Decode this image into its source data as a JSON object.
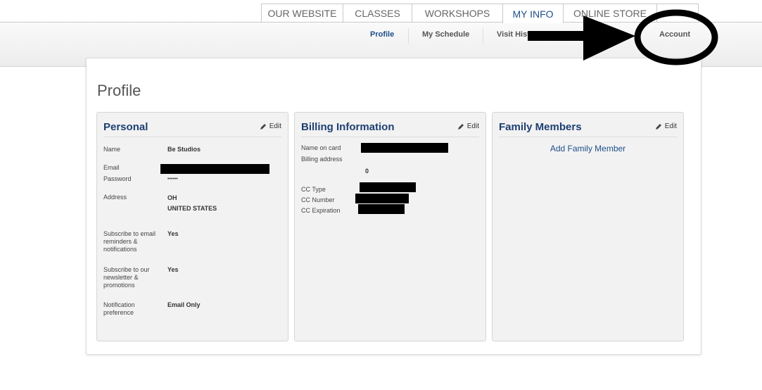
{
  "top_tabs": [
    "OUR WEBSITE",
    "CLASSES",
    "WORKSHOPS",
    "MY INFO",
    "ONLINE STORE"
  ],
  "subnav": {
    "profile": "Profile",
    "my_schedule": "My Schedule",
    "visit_history": "Visit Hist",
    "account": "Account"
  },
  "page": {
    "title": "Profile"
  },
  "edit_label": "Edit",
  "personal": {
    "title": "Personal",
    "name_label": "Name",
    "name_value": "Be Studios",
    "email_label": "Email",
    "password_label": "Password",
    "password_value": "••••••",
    "address_label": "Address",
    "address_line1": "OH",
    "address_line2": "UNITED STATES",
    "email_reminders_label": "Subscribe to email reminders & notifications",
    "email_reminders_value": "Yes",
    "newsletter_label": "Subscribe to our newsletter & promotions",
    "newsletter_value": "Yes",
    "notification_label": "Notification preference",
    "notification_value": "Email Only"
  },
  "billing": {
    "title": "Billing Information",
    "name_on_card_label": "Name on card",
    "billing_address_label": "Billing address",
    "billing_address_value": "0",
    "cc_type_label": "CC Type",
    "cc_number_label": "CC Number",
    "cc_expiration_label": "CC Expiration"
  },
  "family": {
    "title": "Family Members",
    "add_label": "Add Family Member"
  },
  "colors": {
    "accent": "#1e4f8a",
    "heading": "#1e3f72",
    "panel_bg": "#f2f2f2"
  }
}
